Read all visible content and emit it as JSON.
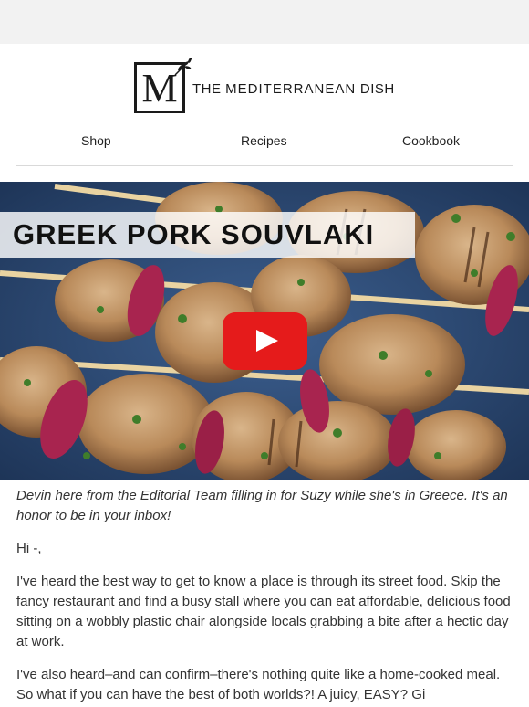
{
  "brand": {
    "logo_letter": "M",
    "name_the": "THE",
    "name_main": "MEDITERRANEAN",
    "name_dish": "DISH"
  },
  "nav": {
    "items": [
      {
        "label": "Shop"
      },
      {
        "label": "Recipes"
      },
      {
        "label": "Cookbook"
      }
    ]
  },
  "hero": {
    "title": "GREEK PORK SOUVLAKI",
    "play_icon": "youtube-play-icon"
  },
  "content": {
    "intro": "Devin here from the Editorial Team filling in for Suzy while she's in Greece. It's an honor to be in your inbox!",
    "greeting": "Hi -,",
    "paragraph_1": "I've heard the best way to get to know a place is through its street food. Skip the fancy restaurant and find a busy stall where you can eat affordable, delicious food sitting on a wobbly plastic chair alongside locals grabbing a bite after a hectic day at work.",
    "paragraph_2": "I've also heard–and can confirm–there's nothing quite like a home-cooked meal. So what if you can have the best of both worlds?! A juicy, EASY? Gi"
  },
  "colors": {
    "accent_red": "#e51b1b",
    "plate_blue": "#2d4d7a",
    "topbar": "#f2f2f2"
  }
}
